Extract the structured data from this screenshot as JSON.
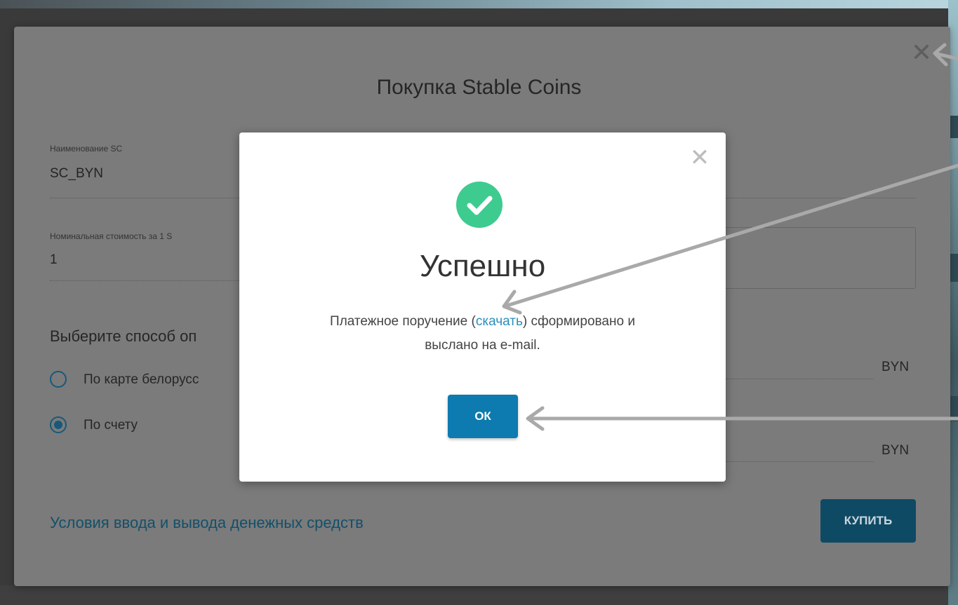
{
  "outer_modal": {
    "title": "Покупка Stable Coins",
    "close_glyph": "✕",
    "fields": [
      {
        "label": "Наименование SC",
        "value": "SC_BYN"
      },
      {
        "label": "Номинальная стоимость за 1 S",
        "value": "1"
      }
    ],
    "payment_section_title": "Выберите способ оп",
    "payment_options": [
      {
        "label": "По карте белорусс",
        "checked": false
      },
      {
        "label": "По счету",
        "checked": true
      }
    ],
    "currency_units": [
      "BYN",
      "BYN"
    ],
    "terms_link": "Условия ввода и вывода денежных средств",
    "buy_button": "КУПИТЬ"
  },
  "success_dialog": {
    "close_glyph": "✕",
    "icon": "check-circle-icon",
    "title": "Успешно",
    "message_before": "Платежное поручение (",
    "message_link": "скачать",
    "message_after_line1": ") сформировано и",
    "message_line2": "выслано на e-mail.",
    "ok_button": "ОК"
  },
  "colors": {
    "success_green": "#3ecb8f",
    "ok_button": "#0d7ab0",
    "link": "#2a8fc0",
    "annotation_arrow": "#a9a9a9"
  }
}
